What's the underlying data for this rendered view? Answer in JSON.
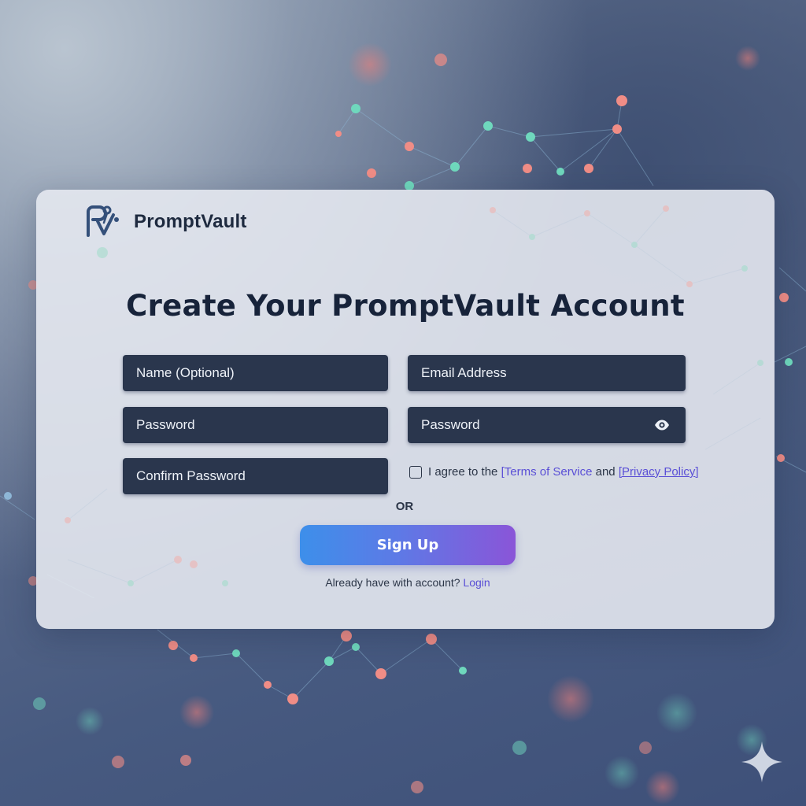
{
  "brand": {
    "name": "PromptVault",
    "logo_icon": "pv-logo-icon"
  },
  "form": {
    "title": "Create Your PromptVault Account",
    "fields": {
      "name_placeholder": "Name (Optional)",
      "email_placeholder": "Email Address",
      "password_placeholder": "Password",
      "password2_placeholder": "Password",
      "confirm_placeholder": "Confirm Password"
    },
    "password_toggle_icon": "eye-icon",
    "agree": {
      "prefix": "I agree to the",
      "terms_label": "[Terms of Service",
      "connector": "and",
      "privacy_label": "[Privacy Policy]",
      "checked": false
    },
    "or_label": "OR",
    "signup_label": "Sign Up",
    "login_prompt": "Already have with account?",
    "login_link": "Login"
  },
  "colors": {
    "accent_link": "#5a4fd6",
    "field_bg": "#2a364d",
    "button_gradient_start": "#3d8fea",
    "button_gradient_end": "#8a55d8",
    "title_text": "#17233a"
  },
  "decor": {
    "corner_icon": "sparkle-icon"
  }
}
